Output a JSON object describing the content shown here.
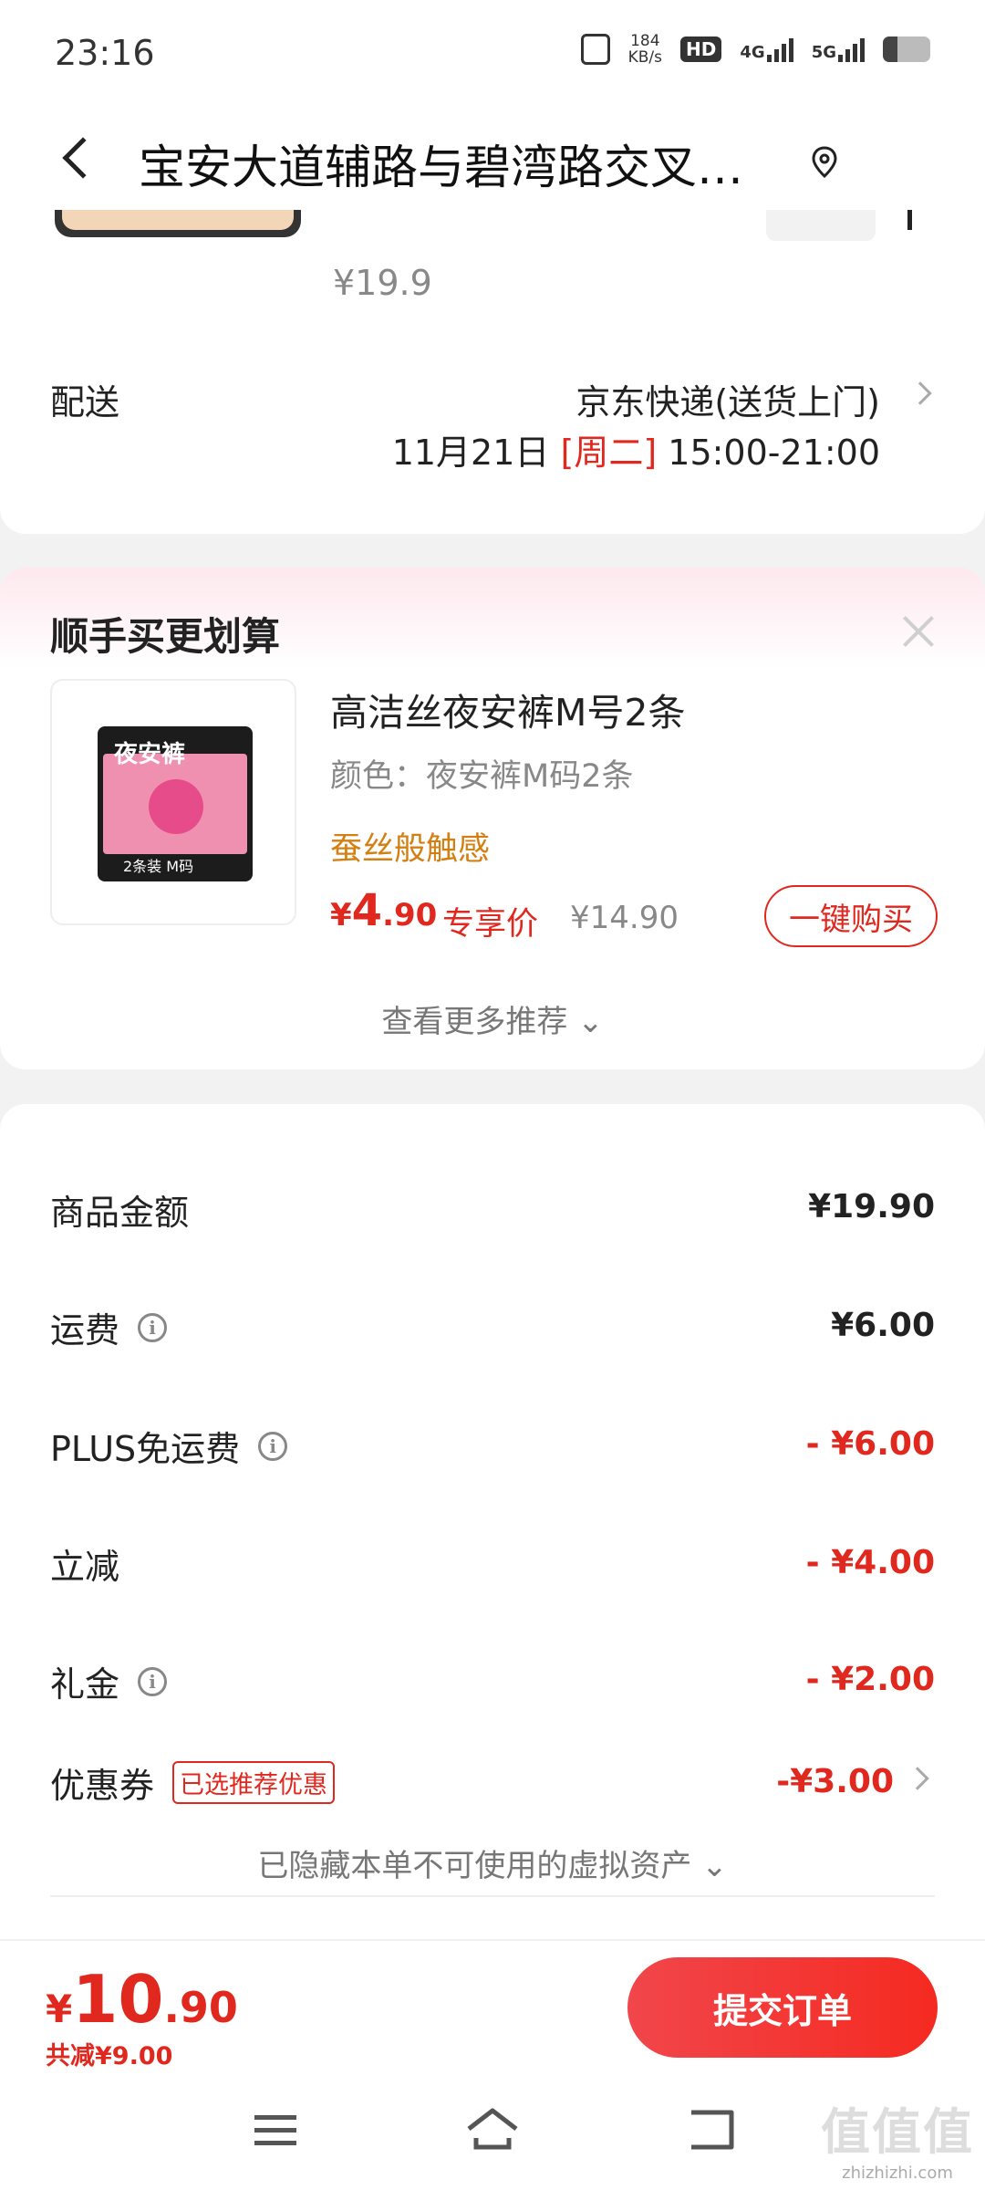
{
  "status_bar": {
    "time": "23:16",
    "speed_value": "184",
    "speed_unit": "KB/s",
    "hd_badge": "HD",
    "net1": "4G",
    "net2": "5G"
  },
  "header": {
    "title": "宝安大道辅路与碧湾路交叉…",
    "back_icon": "chevron-left-icon",
    "location_icon": "location-pin-icon"
  },
  "product": {
    "original_price": "¥19.9"
  },
  "delivery": {
    "label": "配送",
    "method": "京东快递(送货上门)",
    "date": "11月21日",
    "weekday": "[周二]",
    "time_range": "15:00-21:00"
  },
  "recommendation": {
    "title": "顺手买更划算",
    "item": {
      "name": "高洁丝夜安裤M号2条",
      "variant": "颜色：夜安裤M码2条",
      "feature": "蚕丝般触感",
      "price_symbol": "¥",
      "price_int": "4",
      "price_dec": ".90",
      "price_label": "专享价",
      "original_price": "¥14.90",
      "buy_label": "一键购买",
      "pack_logo": "夜安裤",
      "pack_tag": "2条装 M码"
    },
    "more_label": "查看更多推荐 ⌄"
  },
  "summary": {
    "rows": [
      {
        "label": "商品金额",
        "value": "¥19.90"
      },
      {
        "label": "运费",
        "value": "¥6.00"
      },
      {
        "label": "PLUS免运费",
        "value": "- ¥6.00"
      },
      {
        "label": "立减",
        "value": "- ¥4.00"
      },
      {
        "label": "礼金",
        "value": "- ¥2.00"
      },
      {
        "label": "优惠券",
        "value": "-¥3.00",
        "tag": "已选推荐优惠"
      }
    ],
    "hidden_assets": "已隐藏本单不可使用的虚拟资产 ⌄"
  },
  "bottom_bar": {
    "price_symbol": "¥",
    "price_int": "10",
    "price_dec": ".90",
    "saved": "共减¥9.00",
    "submit_label": "提交订单"
  },
  "watermark": {
    "main": "值值值",
    "sub": "zhizhizhi.com"
  },
  "colors": {
    "accent_red": "#e0281f",
    "feature_orange": "#d47f12"
  }
}
